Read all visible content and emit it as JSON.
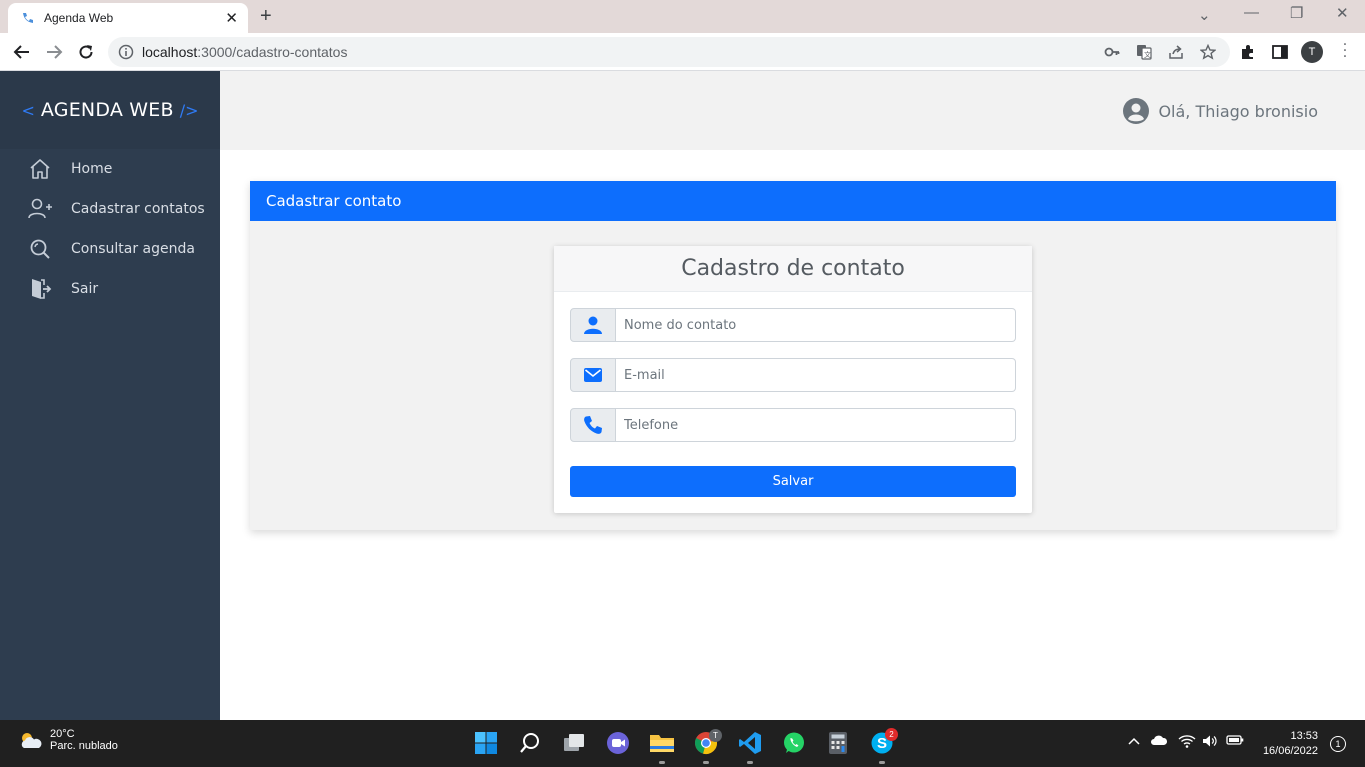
{
  "browser": {
    "tab_title": "Agenda Web",
    "tab_close": "✕",
    "new_tab": "+",
    "url_host": "localhost",
    "url_path": ":3000/cadastro-contatos",
    "profile_initial": "T",
    "window_minimize": "—",
    "window_restore": "❐",
    "window_close": "✕",
    "tab_search": "⌄"
  },
  "sidebar": {
    "brand_open": "<",
    "brand_name": "AGENDA WEB",
    "brand_close": "/>",
    "items": [
      {
        "label": "Home",
        "icon": "home-icon"
      },
      {
        "label": "Cadastrar contatos",
        "icon": "user-plus-icon"
      },
      {
        "label": "Consultar agenda",
        "icon": "search-icon"
      },
      {
        "label": "Sair",
        "icon": "logout-door-icon"
      }
    ]
  },
  "header": {
    "greeting": "Olá, Thiago bronisio"
  },
  "card": {
    "title": "Cadastrar contato",
    "form": {
      "title": "Cadastro de contato",
      "name_placeholder": "Nome do contato",
      "name_value": "",
      "email_placeholder": "E-mail",
      "email_value": "",
      "phone_placeholder": "Telefone",
      "phone_value": "",
      "save_label": "Salvar"
    }
  },
  "taskbar": {
    "weather_temp": "20°C",
    "weather_desc": "Parc. nublado",
    "time": "13:53",
    "date": "16/06/2022",
    "notifications": "1",
    "chrome_badge": "T",
    "skype_badge": "2"
  },
  "colors": {
    "primary": "#0d6efd",
    "sidebar": "#2e3d4f",
    "brand_accent": "#2f7bf5"
  }
}
